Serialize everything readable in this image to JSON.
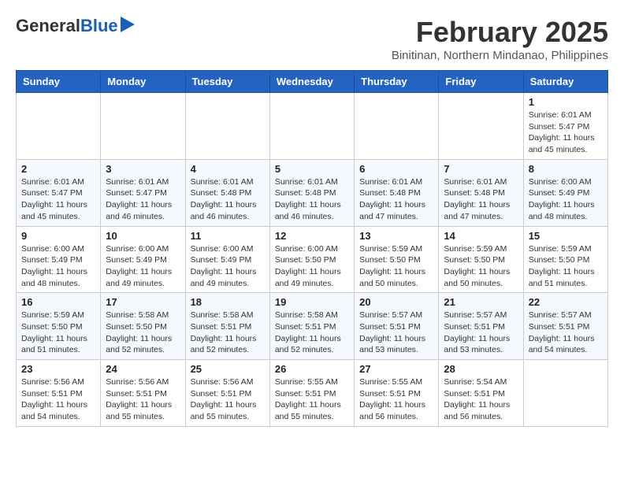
{
  "header": {
    "logo_general": "General",
    "logo_blue": "Blue",
    "month_title": "February 2025",
    "location": "Binitinan, Northern Mindanao, Philippines"
  },
  "days_of_week": [
    "Sunday",
    "Monday",
    "Tuesday",
    "Wednesday",
    "Thursday",
    "Friday",
    "Saturday"
  ],
  "weeks": [
    [
      {
        "day": "",
        "info": ""
      },
      {
        "day": "",
        "info": ""
      },
      {
        "day": "",
        "info": ""
      },
      {
        "day": "",
        "info": ""
      },
      {
        "day": "",
        "info": ""
      },
      {
        "day": "",
        "info": ""
      },
      {
        "day": "1",
        "info": "Sunrise: 6:01 AM\nSunset: 5:47 PM\nDaylight: 11 hours and 45 minutes."
      }
    ],
    [
      {
        "day": "2",
        "info": "Sunrise: 6:01 AM\nSunset: 5:47 PM\nDaylight: 11 hours and 45 minutes."
      },
      {
        "day": "3",
        "info": "Sunrise: 6:01 AM\nSunset: 5:47 PM\nDaylight: 11 hours and 46 minutes."
      },
      {
        "day": "4",
        "info": "Sunrise: 6:01 AM\nSunset: 5:48 PM\nDaylight: 11 hours and 46 minutes."
      },
      {
        "day": "5",
        "info": "Sunrise: 6:01 AM\nSunset: 5:48 PM\nDaylight: 11 hours and 46 minutes."
      },
      {
        "day": "6",
        "info": "Sunrise: 6:01 AM\nSunset: 5:48 PM\nDaylight: 11 hours and 47 minutes."
      },
      {
        "day": "7",
        "info": "Sunrise: 6:01 AM\nSunset: 5:48 PM\nDaylight: 11 hours and 47 minutes."
      },
      {
        "day": "8",
        "info": "Sunrise: 6:00 AM\nSunset: 5:49 PM\nDaylight: 11 hours and 48 minutes."
      }
    ],
    [
      {
        "day": "9",
        "info": "Sunrise: 6:00 AM\nSunset: 5:49 PM\nDaylight: 11 hours and 48 minutes."
      },
      {
        "day": "10",
        "info": "Sunrise: 6:00 AM\nSunset: 5:49 PM\nDaylight: 11 hours and 49 minutes."
      },
      {
        "day": "11",
        "info": "Sunrise: 6:00 AM\nSunset: 5:49 PM\nDaylight: 11 hours and 49 minutes."
      },
      {
        "day": "12",
        "info": "Sunrise: 6:00 AM\nSunset: 5:50 PM\nDaylight: 11 hours and 49 minutes."
      },
      {
        "day": "13",
        "info": "Sunrise: 5:59 AM\nSunset: 5:50 PM\nDaylight: 11 hours and 50 minutes."
      },
      {
        "day": "14",
        "info": "Sunrise: 5:59 AM\nSunset: 5:50 PM\nDaylight: 11 hours and 50 minutes."
      },
      {
        "day": "15",
        "info": "Sunrise: 5:59 AM\nSunset: 5:50 PM\nDaylight: 11 hours and 51 minutes."
      }
    ],
    [
      {
        "day": "16",
        "info": "Sunrise: 5:59 AM\nSunset: 5:50 PM\nDaylight: 11 hours and 51 minutes."
      },
      {
        "day": "17",
        "info": "Sunrise: 5:58 AM\nSunset: 5:50 PM\nDaylight: 11 hours and 52 minutes."
      },
      {
        "day": "18",
        "info": "Sunrise: 5:58 AM\nSunset: 5:51 PM\nDaylight: 11 hours and 52 minutes."
      },
      {
        "day": "19",
        "info": "Sunrise: 5:58 AM\nSunset: 5:51 PM\nDaylight: 11 hours and 52 minutes."
      },
      {
        "day": "20",
        "info": "Sunrise: 5:57 AM\nSunset: 5:51 PM\nDaylight: 11 hours and 53 minutes."
      },
      {
        "day": "21",
        "info": "Sunrise: 5:57 AM\nSunset: 5:51 PM\nDaylight: 11 hours and 53 minutes."
      },
      {
        "day": "22",
        "info": "Sunrise: 5:57 AM\nSunset: 5:51 PM\nDaylight: 11 hours and 54 minutes."
      }
    ],
    [
      {
        "day": "23",
        "info": "Sunrise: 5:56 AM\nSunset: 5:51 PM\nDaylight: 11 hours and 54 minutes."
      },
      {
        "day": "24",
        "info": "Sunrise: 5:56 AM\nSunset: 5:51 PM\nDaylight: 11 hours and 55 minutes."
      },
      {
        "day": "25",
        "info": "Sunrise: 5:56 AM\nSunset: 5:51 PM\nDaylight: 11 hours and 55 minutes."
      },
      {
        "day": "26",
        "info": "Sunrise: 5:55 AM\nSunset: 5:51 PM\nDaylight: 11 hours and 55 minutes."
      },
      {
        "day": "27",
        "info": "Sunrise: 5:55 AM\nSunset: 5:51 PM\nDaylight: 11 hours and 56 minutes."
      },
      {
        "day": "28",
        "info": "Sunrise: 5:54 AM\nSunset: 5:51 PM\nDaylight: 11 hours and 56 minutes."
      },
      {
        "day": "",
        "info": ""
      }
    ]
  ]
}
